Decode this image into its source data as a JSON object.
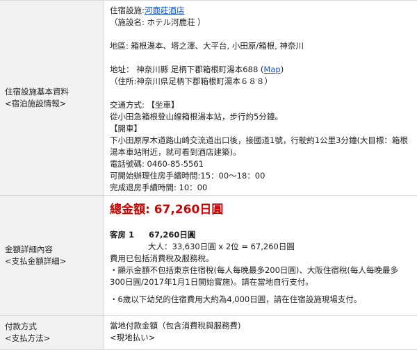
{
  "row1": {
    "label_main": "住宿設施基本資料",
    "label_sub": "<宿泊施設情報>",
    "facility_prefix": "住宿設施:",
    "facility_link": "河鹿莊酒店",
    "facility_jp": "（施設名: ホテル河鹿荘 ）",
    "area": "地區: 箱根湯本、塔之澤、大平台, 小田原/箱根, 神奈川",
    "address_prefix": "地址：  神奈川縣 足柄下郡箱根町湯本688 (",
    "map_link": "Map",
    "address_suffix": ")",
    "address_jp": "（住所:神奈川県足柄下郡箱根町湯本６８８）",
    "transport_title": "交通方式: 【坐車】",
    "transport_train": "從小田急箱根登山線箱根湯本站，步行約5分鐘。",
    "drive_title": "【開車】",
    "drive_text": "下小田原厚木道路山崎交流道出口後，接國道1號，行駛約1公里3分鐘(大目標：箱根湯本車站附近，就可看到酒店建築)。",
    "phone": "電話號碼: 0460-85-5561",
    "checkin": "可開始辦理住房手續時間:15：00～18：00",
    "checkout": "完成退房手續時間: 10：00"
  },
  "row2": {
    "label_main": "金額詳細內容",
    "label_sub": "<支払金額詳細>",
    "total": "總金額: 67,260日圓",
    "room_label": "客房 1",
    "room_amount": "67,260日圓",
    "adult_calc": "大人：33,630日圓 x 2位 = 67,260日圓",
    "tax_included": "費用已包括消費稅及服務稅。",
    "tax_note": "・顯示金額不包括東京住宿稅(每人每晚最多200日圓)、大阪住宿稅(每人每晚最多300日圓/2017年1月1日開始實施)。請在當地自行支付。",
    "child_note": "・6歲以下幼兒的住宿費用大約為4,000日圓，請在住宿設施現場支付。"
  },
  "row3": {
    "label_main": "付款方式",
    "label_sub": "<支払方法>",
    "method": "當地付款金額（包含消費稅與服務費)",
    "method_jp": "<現地払い>"
  }
}
